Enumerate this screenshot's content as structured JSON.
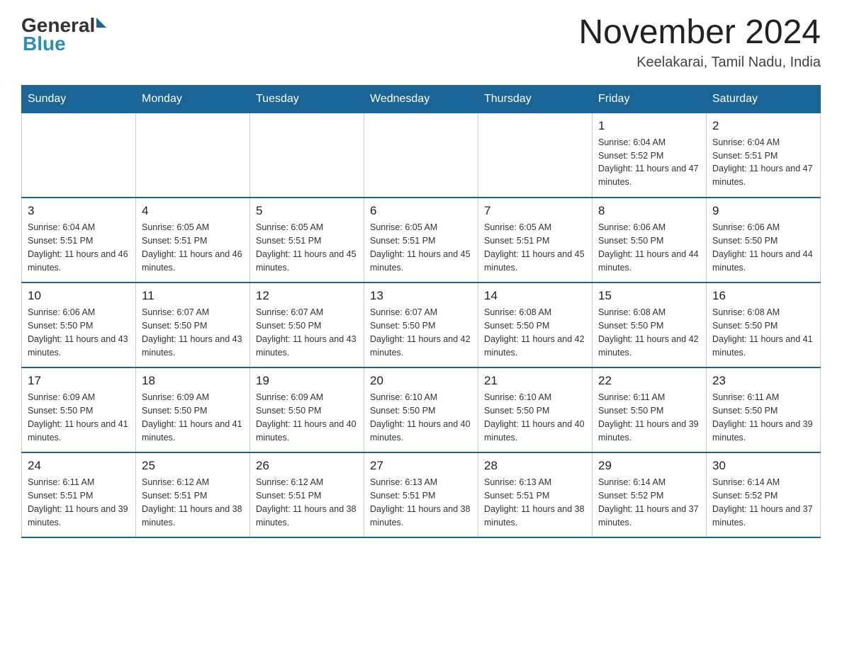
{
  "header": {
    "logo_general": "General",
    "logo_blue": "Blue",
    "month_title": "November 2024",
    "location": "Keelakarai, Tamil Nadu, India"
  },
  "weekdays": [
    "Sunday",
    "Monday",
    "Tuesday",
    "Wednesday",
    "Thursday",
    "Friday",
    "Saturday"
  ],
  "weeks": [
    [
      {
        "day": "",
        "info": ""
      },
      {
        "day": "",
        "info": ""
      },
      {
        "day": "",
        "info": ""
      },
      {
        "day": "",
        "info": ""
      },
      {
        "day": "",
        "info": ""
      },
      {
        "day": "1",
        "info": "Sunrise: 6:04 AM\nSunset: 5:52 PM\nDaylight: 11 hours and 47 minutes."
      },
      {
        "day": "2",
        "info": "Sunrise: 6:04 AM\nSunset: 5:51 PM\nDaylight: 11 hours and 47 minutes."
      }
    ],
    [
      {
        "day": "3",
        "info": "Sunrise: 6:04 AM\nSunset: 5:51 PM\nDaylight: 11 hours and 46 minutes."
      },
      {
        "day": "4",
        "info": "Sunrise: 6:05 AM\nSunset: 5:51 PM\nDaylight: 11 hours and 46 minutes."
      },
      {
        "day": "5",
        "info": "Sunrise: 6:05 AM\nSunset: 5:51 PM\nDaylight: 11 hours and 45 minutes."
      },
      {
        "day": "6",
        "info": "Sunrise: 6:05 AM\nSunset: 5:51 PM\nDaylight: 11 hours and 45 minutes."
      },
      {
        "day": "7",
        "info": "Sunrise: 6:05 AM\nSunset: 5:51 PM\nDaylight: 11 hours and 45 minutes."
      },
      {
        "day": "8",
        "info": "Sunrise: 6:06 AM\nSunset: 5:50 PM\nDaylight: 11 hours and 44 minutes."
      },
      {
        "day": "9",
        "info": "Sunrise: 6:06 AM\nSunset: 5:50 PM\nDaylight: 11 hours and 44 minutes."
      }
    ],
    [
      {
        "day": "10",
        "info": "Sunrise: 6:06 AM\nSunset: 5:50 PM\nDaylight: 11 hours and 43 minutes."
      },
      {
        "day": "11",
        "info": "Sunrise: 6:07 AM\nSunset: 5:50 PM\nDaylight: 11 hours and 43 minutes."
      },
      {
        "day": "12",
        "info": "Sunrise: 6:07 AM\nSunset: 5:50 PM\nDaylight: 11 hours and 43 minutes."
      },
      {
        "day": "13",
        "info": "Sunrise: 6:07 AM\nSunset: 5:50 PM\nDaylight: 11 hours and 42 minutes."
      },
      {
        "day": "14",
        "info": "Sunrise: 6:08 AM\nSunset: 5:50 PM\nDaylight: 11 hours and 42 minutes."
      },
      {
        "day": "15",
        "info": "Sunrise: 6:08 AM\nSunset: 5:50 PM\nDaylight: 11 hours and 42 minutes."
      },
      {
        "day": "16",
        "info": "Sunrise: 6:08 AM\nSunset: 5:50 PM\nDaylight: 11 hours and 41 minutes."
      }
    ],
    [
      {
        "day": "17",
        "info": "Sunrise: 6:09 AM\nSunset: 5:50 PM\nDaylight: 11 hours and 41 minutes."
      },
      {
        "day": "18",
        "info": "Sunrise: 6:09 AM\nSunset: 5:50 PM\nDaylight: 11 hours and 41 minutes."
      },
      {
        "day": "19",
        "info": "Sunrise: 6:09 AM\nSunset: 5:50 PM\nDaylight: 11 hours and 40 minutes."
      },
      {
        "day": "20",
        "info": "Sunrise: 6:10 AM\nSunset: 5:50 PM\nDaylight: 11 hours and 40 minutes."
      },
      {
        "day": "21",
        "info": "Sunrise: 6:10 AM\nSunset: 5:50 PM\nDaylight: 11 hours and 40 minutes."
      },
      {
        "day": "22",
        "info": "Sunrise: 6:11 AM\nSunset: 5:50 PM\nDaylight: 11 hours and 39 minutes."
      },
      {
        "day": "23",
        "info": "Sunrise: 6:11 AM\nSunset: 5:50 PM\nDaylight: 11 hours and 39 minutes."
      }
    ],
    [
      {
        "day": "24",
        "info": "Sunrise: 6:11 AM\nSunset: 5:51 PM\nDaylight: 11 hours and 39 minutes."
      },
      {
        "day": "25",
        "info": "Sunrise: 6:12 AM\nSunset: 5:51 PM\nDaylight: 11 hours and 38 minutes."
      },
      {
        "day": "26",
        "info": "Sunrise: 6:12 AM\nSunset: 5:51 PM\nDaylight: 11 hours and 38 minutes."
      },
      {
        "day": "27",
        "info": "Sunrise: 6:13 AM\nSunset: 5:51 PM\nDaylight: 11 hours and 38 minutes."
      },
      {
        "day": "28",
        "info": "Sunrise: 6:13 AM\nSunset: 5:51 PM\nDaylight: 11 hours and 38 minutes."
      },
      {
        "day": "29",
        "info": "Sunrise: 6:14 AM\nSunset: 5:52 PM\nDaylight: 11 hours and 37 minutes."
      },
      {
        "day": "30",
        "info": "Sunrise: 6:14 AM\nSunset: 5:52 PM\nDaylight: 11 hours and 37 minutes."
      }
    ]
  ]
}
